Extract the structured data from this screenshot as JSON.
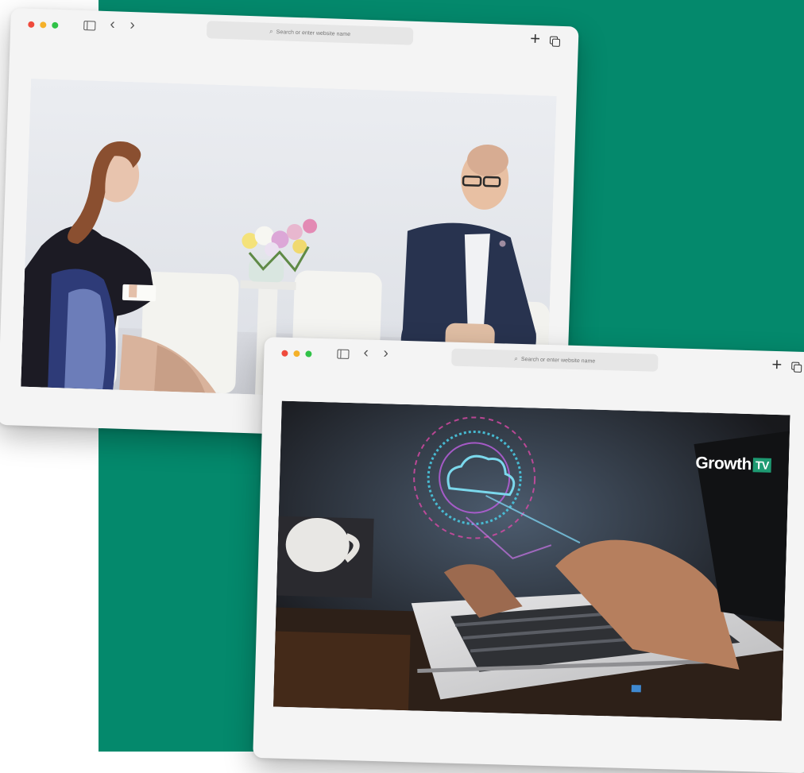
{
  "windows": {
    "back": {
      "address_placeholder": "Search or enter website name",
      "media_alt": "Video interview in studio"
    },
    "front": {
      "address_placeholder": "Search or enter website name",
      "brand": {
        "name": "Growth",
        "tag": "TV"
      },
      "media_alt": "Hands typing on laptop with cloud graphic"
    }
  },
  "colors": {
    "background_green": "#04896c",
    "brand_tag": "#1e9a72",
    "traffic_red": "#ef4a3c",
    "traffic_yellow": "#f5b129",
    "traffic_green": "#30c247"
  },
  "icons": {
    "address_search": "⌕",
    "nav_back": "‹",
    "nav_forward": "›",
    "new_tab": "+"
  }
}
